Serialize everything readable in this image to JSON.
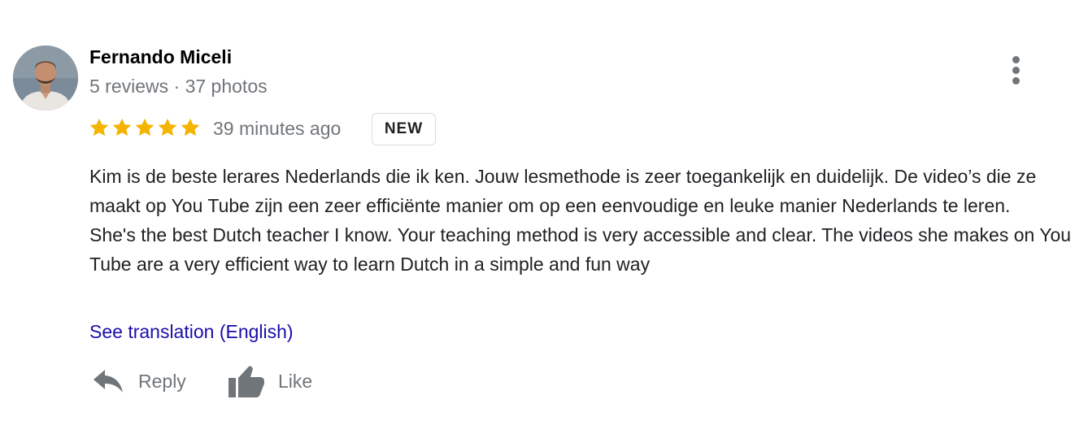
{
  "reviewer": {
    "name": "Fernando Miceli",
    "meta": "5 reviews · 37 photos",
    "avatar_icon": "reviewer-avatar"
  },
  "rating": {
    "stars": 5,
    "max": 5,
    "star_color": "#f4b400"
  },
  "timestamp": "39 minutes ago",
  "badge": "NEW",
  "review_text": {
    "dutch": "Kim is de beste lerares Nederlands die ik ken. Jouw lesmethode is zeer toegankelijk en duidelijk. De video’s die ze maakt op You Tube zijn een zeer efficiënte manier om op een eenvoudige en leuke manier Nederlands te leren.",
    "english": "She's the best Dutch teacher I know. Your teaching method is very accessible and clear. The videos she makes on You Tube are a very efficient way to learn Dutch in a simple and fun way"
  },
  "translate_link": "See translation (English)",
  "link_color": "#1a0dab",
  "actions": {
    "reply": {
      "label": "Reply",
      "icon": "reply-icon"
    },
    "like": {
      "label": "Like",
      "icon": "thumbs-up-icon"
    }
  },
  "menu_icon": "more-vert-icon"
}
